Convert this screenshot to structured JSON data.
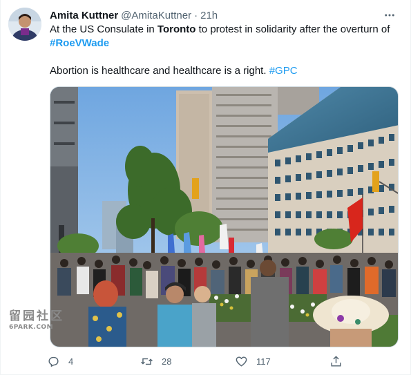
{
  "tweet": {
    "author_name": "Amita Kuttner",
    "handle": "@AmitaKuttner",
    "separator": "·",
    "time": "21h",
    "text": {
      "line1_prefix": "At the US Consulate in ",
      "line1_bold": "Toronto",
      "line1_suffix": " to protest in solidarity after the overturn of",
      "hashtag1": "#RoeVWade",
      "line2_text": "Abortion is healthcare and healthcare is a right. ",
      "hashtag2": "#GPC"
    },
    "actions": {
      "reply_count": "4",
      "retweet_count": "28",
      "like_count": "117"
    }
  },
  "watermark": {
    "chinese": "留园社区",
    "english": "6PARK.COM"
  },
  "colors": {
    "link": "#1d9bf0",
    "secondary_text": "#536471",
    "primary_text": "#0f1419"
  }
}
